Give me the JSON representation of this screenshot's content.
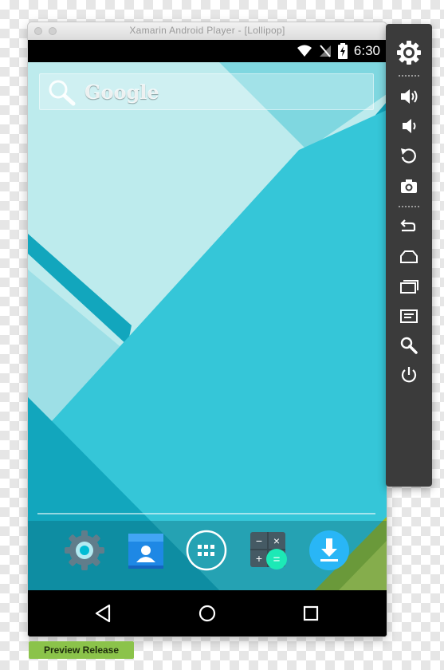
{
  "window": {
    "title": "Xamarin Android Player - [Lollipop]"
  },
  "status_bar": {
    "time": "6:30",
    "icons": [
      "wifi-icon",
      "no-signal-icon",
      "battery-charging-icon"
    ]
  },
  "home_screen": {
    "search_widget": {
      "label": "Google",
      "icon": "search-icon"
    },
    "dock_apps": [
      {
        "name": "settings-app",
        "icon": "gear-icon"
      },
      {
        "name": "contacts-app",
        "icon": "contact-card-icon"
      },
      {
        "name": "app-drawer",
        "icon": "grid-dots-icon"
      },
      {
        "name": "calculator-app",
        "icon": "calculator-icon"
      },
      {
        "name": "downloads-app",
        "icon": "download-arrow-icon"
      }
    ],
    "wallpaper_colors": {
      "cyan": "#35c6d8",
      "teal": "#12a6bd",
      "pale": "#bdebed",
      "deep": "#0a5f70"
    }
  },
  "nav_bar": {
    "buttons": [
      "back-icon",
      "home-icon",
      "recents-icon"
    ]
  },
  "side_panel": {
    "buttons": [
      "settings-gear-icon",
      "volume-up-icon",
      "volume-down-icon",
      "rotate-icon",
      "camera-icon",
      "back-icon",
      "home-icon",
      "recents-icon",
      "menu-icon",
      "search-icon",
      "power-icon"
    ]
  },
  "footer": {
    "badge": "Preview Release",
    "badge_color": "#8bc34a"
  }
}
